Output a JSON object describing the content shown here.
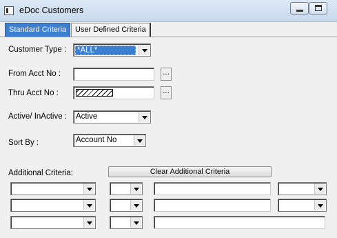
{
  "window": {
    "title": "eDoc Customers"
  },
  "tabs": [
    {
      "label": "Standard Criteria",
      "active": true
    },
    {
      "label": "User Defined Criteria",
      "active": false
    }
  ],
  "form": {
    "customer_type": {
      "label": "Customer Type :",
      "value": "*ALL*"
    },
    "from_acct": {
      "label": "From Acct No :",
      "value": ""
    },
    "thru_acct": {
      "label": "Thru Acct No :",
      "value": ""
    },
    "active": {
      "label": "Active/ InActive :",
      "value": "Active"
    },
    "sort_by": {
      "label": "Sort By  :",
      "value": "Account No"
    }
  },
  "additional": {
    "label": "Additional Criteria:",
    "clear_label": "Clear Additional Criteria"
  },
  "colors": {
    "accent": "#3c7fd1",
    "window_bg": "#f0f0f0"
  }
}
